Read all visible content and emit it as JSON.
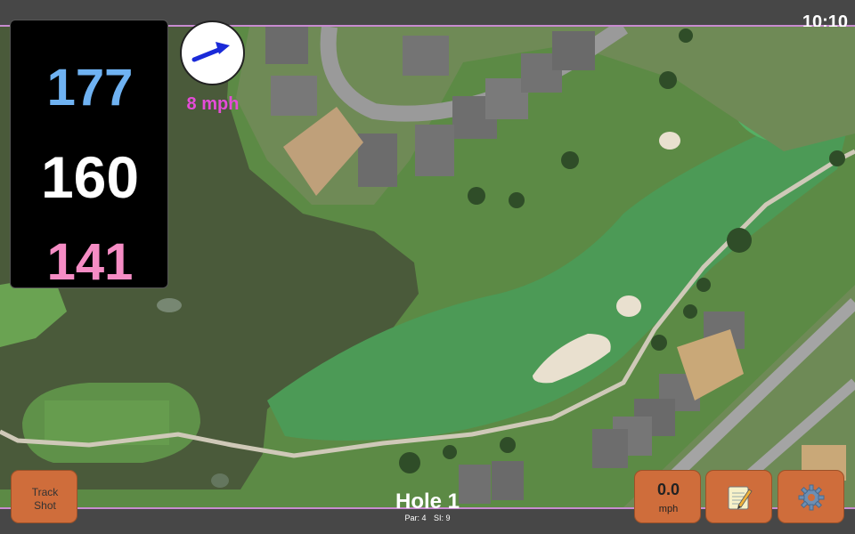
{
  "status": {
    "clock": "10:10"
  },
  "yardages": {
    "back": "177",
    "middle": "160",
    "front": "141"
  },
  "wind": {
    "speed": "8 mph",
    "icon": "wind-direction-arrow-icon"
  },
  "hole": {
    "title": "Hole 1",
    "par": "Par: 4",
    "si": "SI: 9"
  },
  "buttons": {
    "track_shot_line1": "Track",
    "track_shot_line2": "Shot",
    "speed_value": "0.0",
    "speed_unit": "mph",
    "notes_icon": "notepad-icon",
    "settings_icon": "gear-icon"
  },
  "colors": {
    "back_yardage": "#6fb2f2",
    "middle_yardage": "#ffffff",
    "front_yardage": "#f58cc4",
    "wind_text": "#e54cd8",
    "accent_border": "#c88bd0",
    "button": "#cf6d3b"
  }
}
